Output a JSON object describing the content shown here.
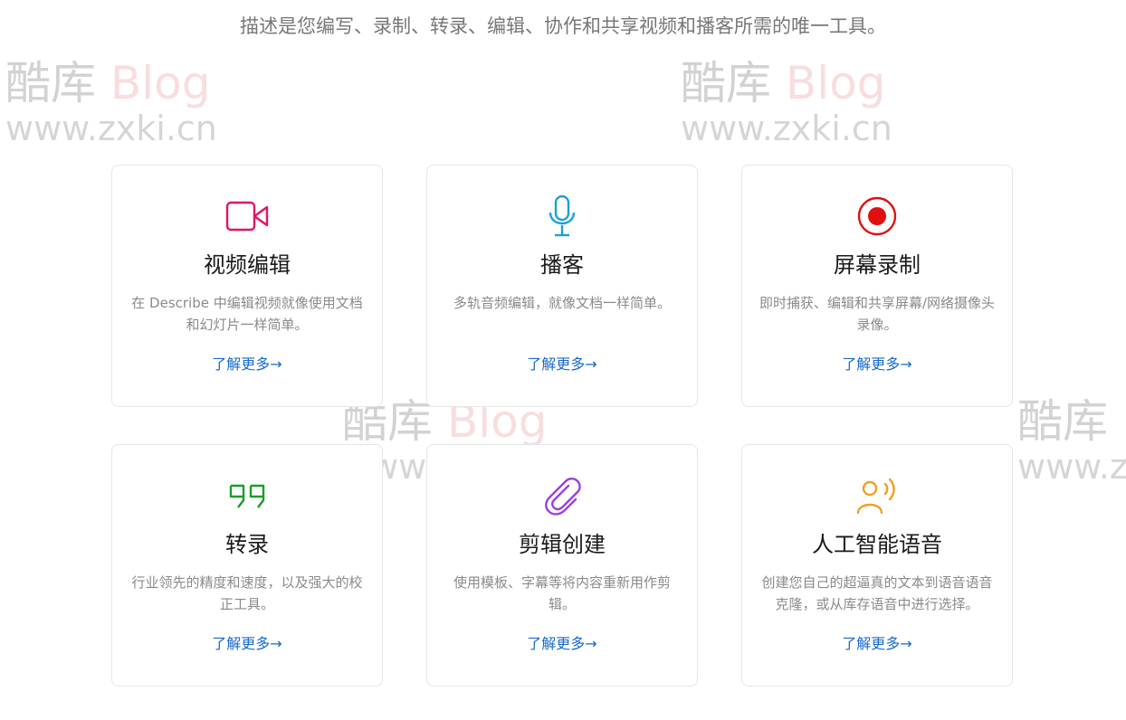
{
  "intro": "描述是您编写、录制、转录、编辑、协作和共享视频和播客所需的唯一工具。",
  "watermark": {
    "brand_cn": "酷库",
    "brand_en": "Blog",
    "url": "www.zxki.cn"
  },
  "cards": [
    {
      "icon": "video-camera-icon",
      "icon_color": "#e0136c",
      "title": "视频编辑",
      "desc": "在 Describe 中编辑视频就像使用文档和幻灯片一样简单。",
      "link": "了解更多→"
    },
    {
      "icon": "microphone-icon",
      "icon_color": "#1a9fd8",
      "title": "播客",
      "desc": "多轨音频编辑，就像文档一样简单。",
      "link": "了解更多→"
    },
    {
      "icon": "record-icon",
      "icon_color": "#e01010",
      "title": "屏幕录制",
      "desc": "即时捕获、编辑和共享屏幕/网络摄像头录像。",
      "link": "了解更多→"
    },
    {
      "icon": "quote-icon",
      "icon_color": "#1a9e2a",
      "title": "转录",
      "desc": "行业领先的精度和速度，以及强大的校正工具。",
      "link": "了解更多→"
    },
    {
      "icon": "paperclip-icon",
      "icon_color": "#9b3fe0",
      "title": "剪辑创建",
      "desc": "使用模板、字幕等将内容重新用作剪辑。",
      "link": "了解更多→"
    },
    {
      "icon": "speaking-person-icon",
      "icon_color": "#f0a020",
      "title": "人工智能语音",
      "desc": "创建您自己的超逼真的文本到语音语音克隆，或从库存语音中进行选择。",
      "link": "了解更多→"
    }
  ]
}
